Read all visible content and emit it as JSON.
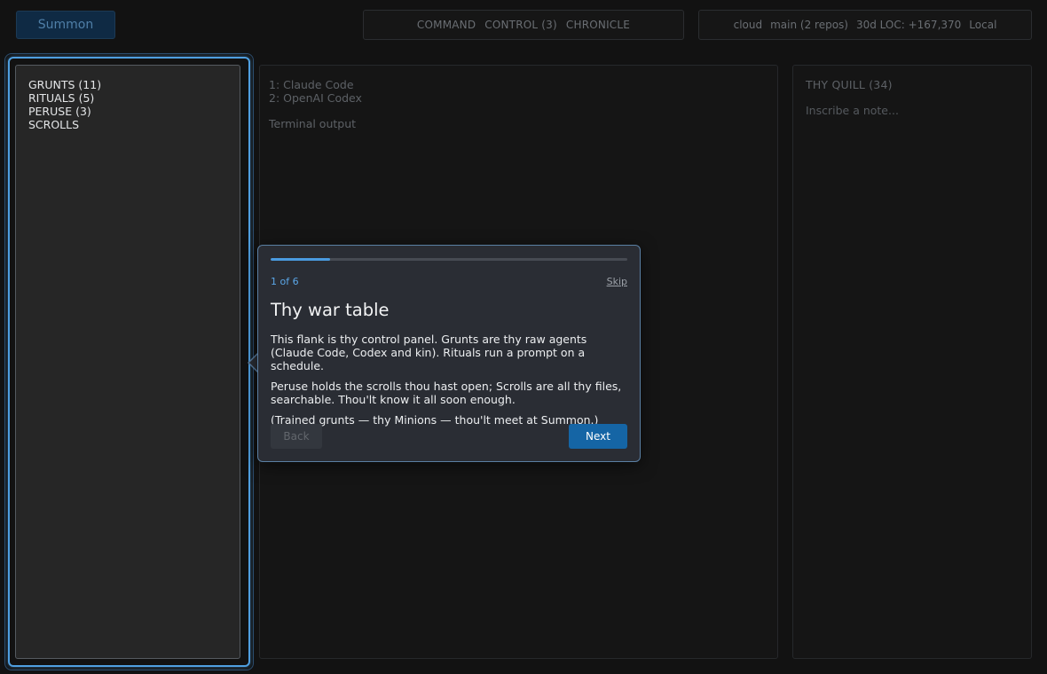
{
  "header": {
    "summon_label": "Summon",
    "nav": [
      "COMMAND",
      "CONTROL (3)",
      "CHRONICLE"
    ],
    "status": [
      "cloud",
      "main (2 repos)",
      "30d LOC: +167,370",
      "Local"
    ]
  },
  "left_panel": {
    "items": [
      "GRUNTS (11)",
      "RITUALS (5)",
      "PERUSE (3)",
      "SCROLLS"
    ]
  },
  "center_panel": {
    "agents": [
      "1: Claude Code",
      "2: OpenAI Codex"
    ],
    "terminal_label": "Terminal output"
  },
  "right_panel": {
    "title": "THY QUILL (34)",
    "note_placeholder": "Inscribe a note..."
  },
  "tour": {
    "step_label": "1 of 6",
    "progress_fraction": 0.1667,
    "skip_label": "Skip",
    "title": "Thy war table",
    "paragraphs": [
      "This flank is thy control panel. Grunts are thy raw agents (Claude Code, Codex and kin). Rituals run a prompt on a schedule.",
      "Peruse holds the scrolls thou hast open; Scrolls are all thy files, searchable. Thou'lt know it all soon enough.",
      "(Trained grunts — thy Minions — thou'lt meet at Summon.)"
    ],
    "back_label": "Back",
    "next_label": "Next"
  },
  "colors": {
    "accent": "#4a9be0",
    "primary_button": "#1565a5",
    "highlight_ring": "#4f9fe0"
  }
}
